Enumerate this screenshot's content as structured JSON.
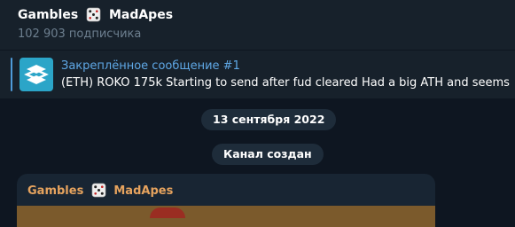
{
  "header": {
    "channel_name": "Gambles",
    "channel_name_suffix": "MadApes",
    "subscribers": "102 903 подписчика",
    "dice_icon": "dice-icon"
  },
  "pinned": {
    "title": "Закреплённое сообщение #1",
    "text": "(ETH) ROKO 175k  Starting to send after fud cleared Had a big ATH and seems",
    "logo_icon": "channel-logo-icon"
  },
  "feed": {
    "date_separator": "13 сентября 2022",
    "service_message": "Канал создан"
  },
  "message": {
    "author": "Gambles",
    "author_suffix": "MadApes"
  },
  "colors": {
    "background": "#0e1621",
    "header_bg": "#17212b",
    "accent_blue": "#5fa8e6",
    "author_orange": "#e6a35e",
    "muted_text": "#6d7f8f"
  }
}
